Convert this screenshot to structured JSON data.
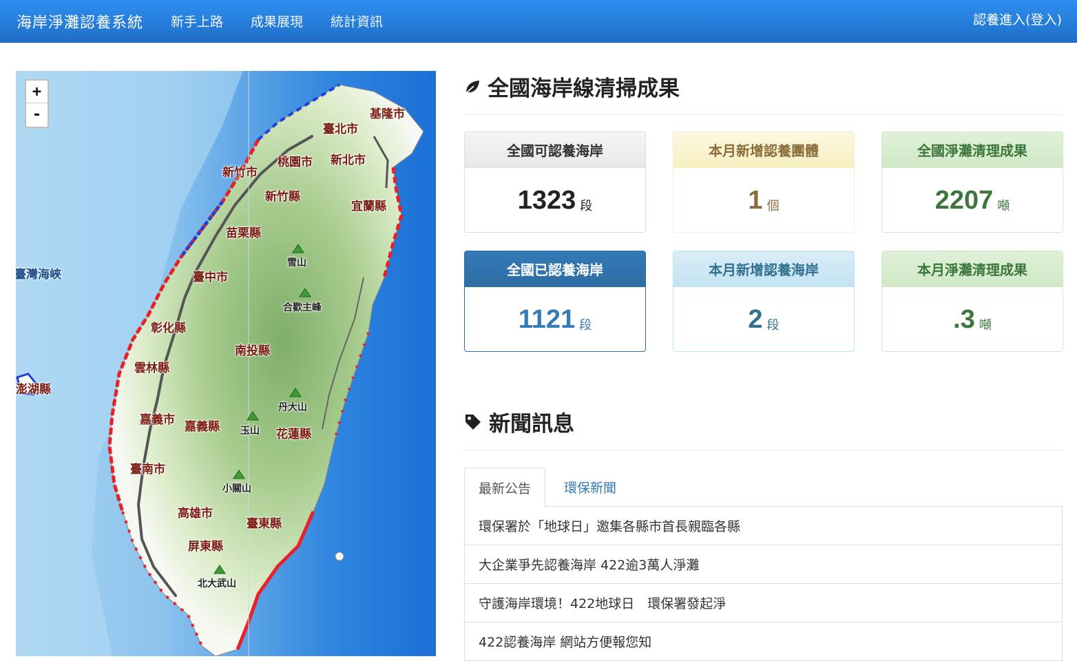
{
  "navbar": {
    "brand": "海岸淨灘認養系統",
    "items": [
      "新手上路",
      "成果展現",
      "統計資訊"
    ],
    "login": "認養進入(登入)"
  },
  "map": {
    "zoom_in": "+",
    "zoom_out": "-",
    "labels": {
      "strait": "臺灣海峽",
      "penghu": "澎湖縣",
      "keelung": "基隆市",
      "taipei": "臺北市",
      "newtaipei": "新北市",
      "taoyuan": "桃園市",
      "hsinchu_city": "新竹市",
      "hsinchu_county": "新竹縣",
      "yilan": "宜蘭縣",
      "miaoli": "苗栗縣",
      "taichung": "臺中市",
      "changhua": "彰化縣",
      "nantou": "南投縣",
      "yunlin": "雲林縣",
      "chiayi_city": "嘉義市",
      "chiayi_county": "嘉義縣",
      "hualien": "花蓮縣",
      "tainan": "臺南市",
      "kaohsiung": "高雄市",
      "taitung": "臺東縣",
      "pingtung": "屏東縣",
      "xueshan": "雪山",
      "hehuan": "合歡主峰",
      "dandashan": "丹大山",
      "yushan": "玉山",
      "xiaoguanshan": "小關山",
      "beidawushan": "北大武山"
    }
  },
  "summary": {
    "title": "全國海岸線清掃成果",
    "panels": [
      {
        "label": "全國可認養海岸",
        "value": "1323",
        "unit": "段"
      },
      {
        "label": "本月新增認養團體",
        "value": "1",
        "unit": "個"
      },
      {
        "label": "全國淨灘清理成果",
        "value": "2207",
        "unit": "噸"
      },
      {
        "label": "全國已認養海岸",
        "value": "1121",
        "unit": "段"
      },
      {
        "label": "本月新增認養海岸",
        "value": "2",
        "unit": "段"
      },
      {
        "label": "本月淨灘清理成果",
        "value": ".3",
        "unit": "噸"
      }
    ]
  },
  "news": {
    "title": "新聞訊息",
    "tabs": [
      "最新公告",
      "環保新聞"
    ],
    "items": [
      "環保署於「地球日」邀集各縣市首長親臨各縣",
      "大企業爭先認養海岸 422逾3萬人淨灘",
      "守護海岸環境！422地球日　環保署發起淨",
      "422認養海岸 網站方便報您知"
    ]
  },
  "colors": {
    "navbar": "#2d8ff0",
    "sea": "#5aa7e8",
    "coast_red": "#e8202a",
    "coast_blue": "#1f3fd8"
  }
}
